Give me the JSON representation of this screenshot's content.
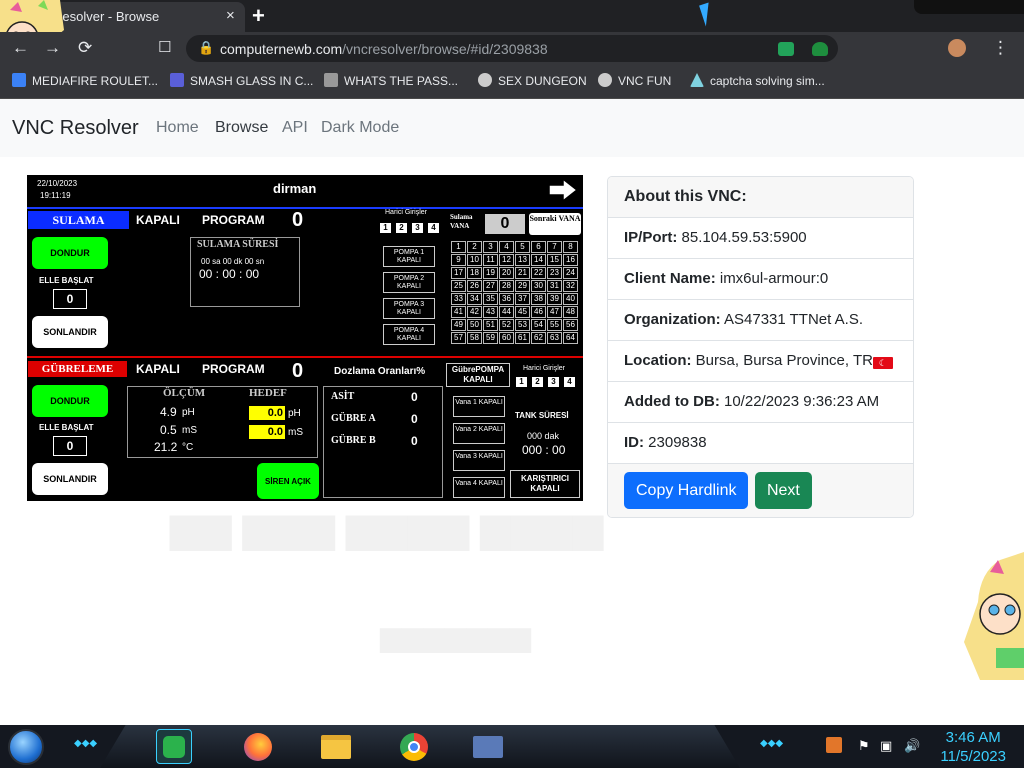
{
  "browser": {
    "tab_title": "C Resolver - Browse",
    "tab_close": "×",
    "new_tab": "+",
    "url_host": "computernewb.com",
    "url_path": "/vncresolver/browse/#id/2309838",
    "bookmarks": [
      {
        "label": "MEDIAFIRE ROULET...",
        "icon": "mediafire-icon",
        "color": "#3b82f6"
      },
      {
        "label": "SMASH GLASS IN C...",
        "icon": "bracket-icon",
        "color": "#5a5fd8"
      },
      {
        "label": "WHATS THE PASS...",
        "icon": "page-icon",
        "color": "#999999"
      },
      {
        "label": "SEX DUNGEON",
        "icon": "gear-icon",
        "color": "#cccccc"
      },
      {
        "label": "VNC FUN",
        "icon": "gear-icon",
        "color": "#cccccc"
      },
      {
        "label": "captcha solving sim...",
        "icon": "caret-icon",
        "color": "#7fd2e0"
      }
    ]
  },
  "navbar": {
    "brand": "VNC Resolver",
    "links": [
      "Home",
      "Browse",
      "API",
      "Dark Mode"
    ]
  },
  "vnc_screen": {
    "date": "22/10/2023",
    "time": "19:11:19",
    "title": "dirman",
    "sulama": "SULAMA",
    "kapali": "KAPALI",
    "program": "PROGRAM",
    "program_value": "0",
    "dondur": "DONDUR",
    "elle_baslat": "ELLE BAŞLAT",
    "elle_value": "0",
    "sonlandir": "SONLANDIR",
    "sulama_suresi": "SULAMA SÜRESİ",
    "sure_units": "00 sa   00   dk  00 sn",
    "sure_value": "00 : 00 : 00",
    "harici_girisler": "Harici Girişler",
    "harici_nums": [
      "1",
      "2",
      "3",
      "4"
    ],
    "sulama_vana": "Sulama VANA",
    "vana_value": "0",
    "sonraki_vana": "Sonraki VANA",
    "pompa": [
      "POMPA 1 KAPALI",
      "POMPA 2 KAPALI",
      "POMPA 3 KAPALI",
      "POMPA 4 KAPALI"
    ],
    "grid": [
      "1",
      "2",
      "3",
      "4",
      "5",
      "6",
      "7",
      "8",
      "9",
      "10",
      "11",
      "12",
      "13",
      "14",
      "15",
      "16",
      "17",
      "18",
      "19",
      "20",
      "21",
      "22",
      "23",
      "24",
      "25",
      "26",
      "27",
      "28",
      "29",
      "30",
      "31",
      "32",
      "33",
      "34",
      "35",
      "36",
      "37",
      "38",
      "39",
      "40",
      "41",
      "42",
      "43",
      "44",
      "45",
      "46",
      "47",
      "48",
      "49",
      "50",
      "51",
      "52",
      "53",
      "54",
      "55",
      "56",
      "57",
      "58",
      "59",
      "60",
      "61",
      "62",
      "63",
      "64"
    ],
    "gubreleme": "GÜBRELEME",
    "kapali2": "KAPALI",
    "program2": "PROGRAM",
    "program2_value": "0",
    "dozlama": "Dozlama Oranları%",
    "gubre_pompa": "GübrePOMPA KAPALI",
    "harici_girisler2": "Harici Girişler",
    "olcum": "ÖLÇÜM",
    "hedef": "HEDEF",
    "ph_value": "4.9",
    "ph_unit": "pH",
    "ms_value": "0.5",
    "ms_unit": "mS",
    "temp_value": "21.2",
    "temp_unit": "°C",
    "hedef_ph": "0.0",
    "hedef_ms": "0.0",
    "asit": "ASİT",
    "asit_value": "0",
    "gubre_a": "GÜBRE A",
    "gubre_a_value": "0",
    "gubre_b": "GÜBRE B",
    "gubre_b_value": "0",
    "vana_boxes": [
      "Vana 1 KAPALI",
      "Vana 2 KAPALI",
      "Vana 3 KAPALI",
      "Vana 4 KAPALI"
    ],
    "tank_suresi": "TANK SÜRESİ",
    "tank_units": "000   dak",
    "tank_value": "000 : 00",
    "karistirici": "KARIŞTIRICI KAPALI",
    "siren": "SİREN AÇIK",
    "dondur2": "DONDUR",
    "elle_baslat2": "ELLE BAŞLAT",
    "elle2_value": "0",
    "sonlandir2": "SONLANDIR"
  },
  "about": {
    "header": "About this VNC:",
    "rows": [
      {
        "label": "IP/Port:",
        "value": "85.104.59.53:5900"
      },
      {
        "label": "Client Name:",
        "value": "imx6ul-armour:0"
      },
      {
        "label": "Organization:",
        "value": "AS47331 TTNet A.S."
      },
      {
        "label": "Location:",
        "value": "Bursa, Bursa Province, TR"
      },
      {
        "label": "Added to DB:",
        "value": "10/22/2023 9:36:23 AM"
      },
      {
        "label": "ID:",
        "value": "2309838"
      }
    ],
    "copy_button": "Copy Hardlink",
    "next_button": "Next",
    "flag_color": "#e30a17"
  },
  "taskbar": {
    "time": "3:46 AM",
    "date": "11/5/2023",
    "accent": "#3ad0ff"
  }
}
